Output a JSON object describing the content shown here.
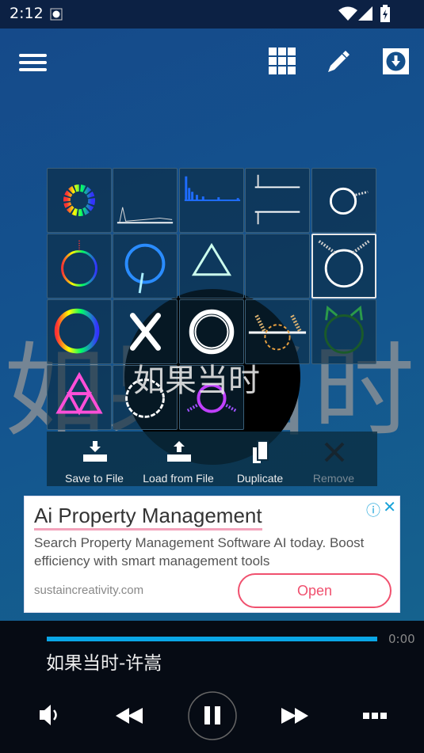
{
  "status_bar": {
    "time": "2:12",
    "icons": [
      "screen-record-icon",
      "wifi-icon",
      "signal-icon",
      "battery-charging-icon"
    ]
  },
  "toolbar": {
    "icons": [
      "menu-icon",
      "grid-icon",
      "pencil-icon",
      "download-icon"
    ]
  },
  "background_lyric": "如果当时",
  "center_lyric": "如果当时",
  "presets": {
    "selected_index": 9,
    "items": [
      "rainbow-ring",
      "white-bars",
      "blue-spectrum",
      "mirror-bars",
      "white-ring",
      "rainbow-circle",
      "blue-circle",
      "triangle",
      "fire-spectrum",
      "white-glow-circle",
      "rainbow-ring-2",
      "x-mark",
      "white-ring-thick",
      "gold-mirror",
      "green-cat-ring",
      "pink-triangle",
      "white-dots-ring",
      "purple-ring"
    ]
  },
  "actions": [
    {
      "label": "Save to File",
      "icon": "save-to-file-icon",
      "enabled": true
    },
    {
      "label": "Load from File",
      "icon": "load-from-file-icon",
      "enabled": true
    },
    {
      "label": "Duplicate",
      "icon": "duplicate-icon",
      "enabled": true
    },
    {
      "label": "Remove",
      "icon": "remove-icon",
      "enabled": false
    }
  ],
  "ad": {
    "title": "Ai Property Management",
    "description": "Search Property Management Software AI today. Boost efficiency with smart management tools",
    "url": "sustaincreativity.com",
    "cta": "Open",
    "info_glyph": "ⓘ",
    "close_glyph": "✕"
  },
  "player": {
    "progress": 1.0,
    "time": "0:00",
    "song": "如果当时-许嵩",
    "accent": "#0aa6e6"
  }
}
